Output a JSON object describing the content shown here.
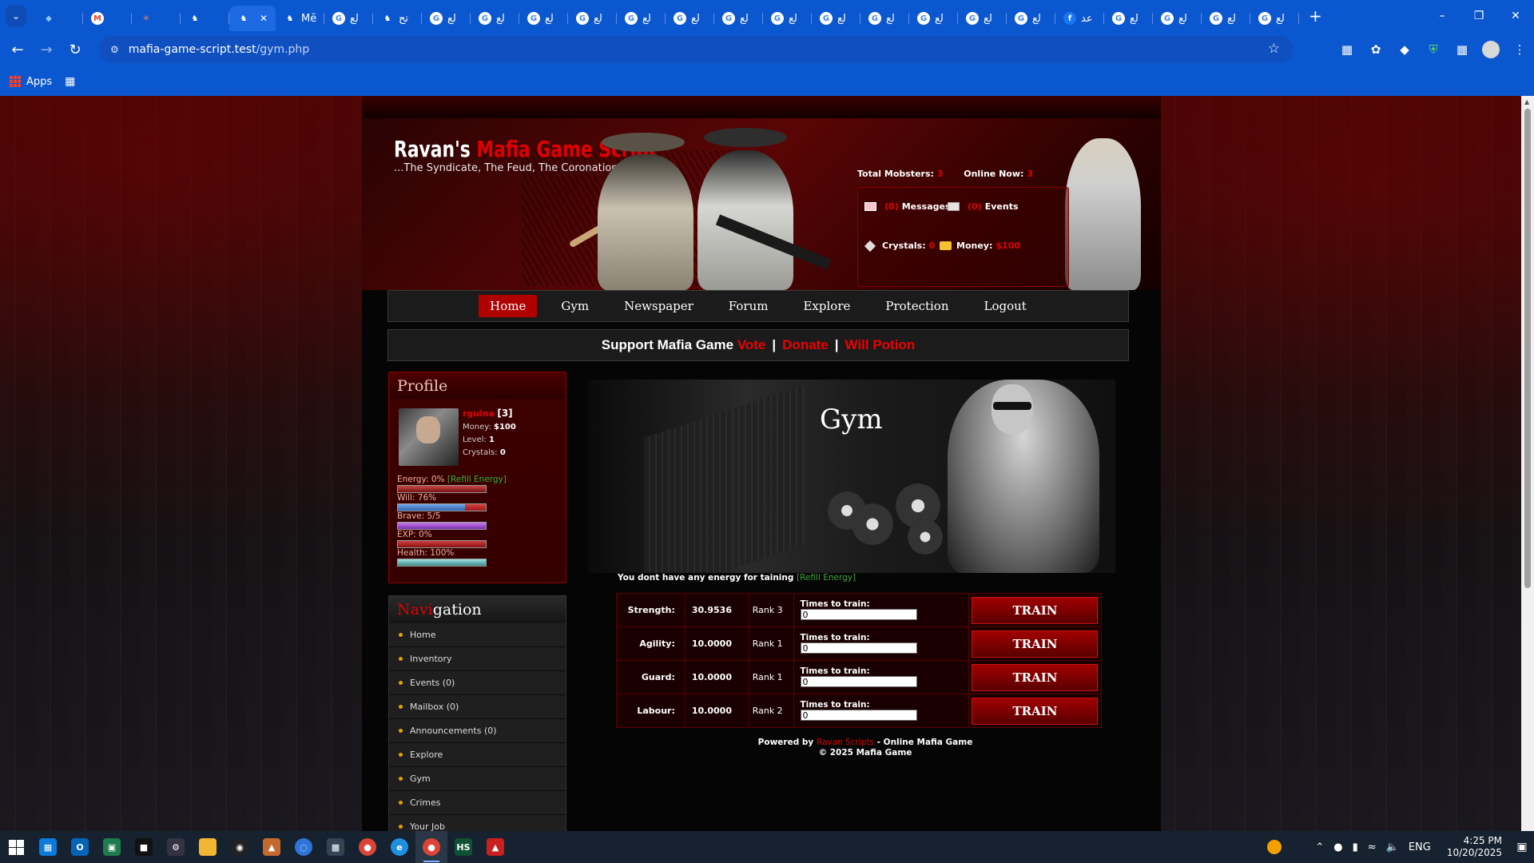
{
  "browser": {
    "tabs": [
      {
        "label": "",
        "favicon": "maps-pin-icon"
      },
      {
        "label": "",
        "favicon": "gmail-icon"
      },
      {
        "label": "",
        "favicon": "claude-icon"
      },
      {
        "label": "",
        "favicon": "mafia-icon"
      },
      {
        "label": "",
        "favicon": "mafia-icon",
        "active": true
      },
      {
        "label": "Mĕ",
        "favicon": "mafia-icon"
      },
      {
        "label": "لع",
        "favicon": "google-icon"
      },
      {
        "label": "تح",
        "favicon": "mafia-icon"
      },
      {
        "label": "لع",
        "favicon": "google-icon"
      },
      {
        "label": "لع",
        "favicon": "google-icon"
      },
      {
        "label": "لع",
        "favicon": "google-icon"
      },
      {
        "label": "لع",
        "favicon": "google-icon"
      },
      {
        "label": "لع",
        "favicon": "google-icon"
      },
      {
        "label": "لع",
        "favicon": "google-icon"
      },
      {
        "label": "لع",
        "favicon": "google-icon"
      },
      {
        "label": "لع",
        "favicon": "google-icon"
      },
      {
        "label": "لع",
        "favicon": "google-icon"
      },
      {
        "label": "لع",
        "favicon": "google-icon"
      },
      {
        "label": "لع",
        "favicon": "google-icon"
      },
      {
        "label": "لع",
        "favicon": "google-icon"
      },
      {
        "label": "لع",
        "favicon": "google-icon"
      },
      {
        "label": "عد",
        "favicon": "facebook-icon"
      },
      {
        "label": "لع",
        "favicon": "google-icon"
      },
      {
        "label": "لع",
        "favicon": "google-icon"
      },
      {
        "label": "لع",
        "favicon": "google-icon"
      },
      {
        "label": "لع",
        "favicon": "google-icon"
      }
    ],
    "url_host": "mafia-game-script.test",
    "url_path": "/gym.php",
    "bookmarks_apps": "Apps"
  },
  "header": {
    "logo_white": "Ravan's ",
    "logo_red": "Mafia Game Script",
    "tagline": "...The Syndicate, The Feud, The Coronation",
    "total_mobsters_label": "Total Mobsters:",
    "total_mobsters_value": "3",
    "online_now_label": "Online Now:",
    "online_now_value": "3",
    "messages_count": "(0)",
    "messages_label": "Messages",
    "events_count": "(0)",
    "events_label": "Events",
    "crystals_label": "Crystals:",
    "crystals_value": "0",
    "money_label": "Money:",
    "money_value": "$100"
  },
  "mainnav": [
    "Home",
    "Gym",
    "Newspaper",
    "Forum",
    "Explore",
    "Protection",
    "Logout"
  ],
  "support": {
    "text": "Support Mafia Game",
    "vote": "Vote",
    "donate": "Donate",
    "will_potion": "Will Potion",
    "sep": "|"
  },
  "profile": {
    "title": "Profile",
    "name": "rguina",
    "level_badge": "[3]",
    "money_label": "Money:",
    "money": "$100",
    "level_label": "Level:",
    "level": "1",
    "crystals_label": "Crystals:",
    "crystals": "0",
    "energy_label": "Energy: 0%",
    "refill_energy": "[Refill Energy]",
    "will_label": "Will: 76%",
    "brave_label": "Brave: 5/5",
    "exp_label": "EXP: 0%",
    "health_label": "Health: 100%",
    "energy_pct": 0,
    "will_pct": 76,
    "brave_pct": 100,
    "exp_pct": 0,
    "health_pct": 100
  },
  "navigation": {
    "title_red": "Navi",
    "title_white": "gation",
    "items": [
      "Home",
      "Inventory",
      "Events (0)",
      "Mailbox (0)",
      "Announcements (0)",
      "Explore",
      "Gym",
      "Crimes",
      "Your Job"
    ]
  },
  "gym": {
    "title": "Gym",
    "no_energy_text": "You dont have any energy for taining",
    "refill_energy": "[Refill Energy]",
    "times_label": "Times to train:",
    "train_label": "TRAIN",
    "rows": [
      {
        "stat": "Strength:",
        "value": "30.9536",
        "rank": "Rank 3",
        "times": "0"
      },
      {
        "stat": "Agility:",
        "value": "10.0000",
        "rank": "Rank 1",
        "times": "0"
      },
      {
        "stat": "Guard:",
        "value": "10.0000",
        "rank": "Rank 1",
        "times": "0"
      },
      {
        "stat": "Labour:",
        "value": "10.0000",
        "rank": "Rank 2",
        "times": "0"
      }
    ]
  },
  "footer": {
    "powered": "Powered by",
    "brand": "Ravan Scripts",
    "suffix": "- Online Mafia Game",
    "copyright": "© 2025 Mafia Game"
  },
  "taskbar": {
    "lang": "ENG",
    "time": "4:25 PM",
    "date": "10/20/2025"
  },
  "colors": {
    "accent_red": "#e00000",
    "browser_blue": "#0b57d0",
    "refill_green": "#35b035"
  }
}
